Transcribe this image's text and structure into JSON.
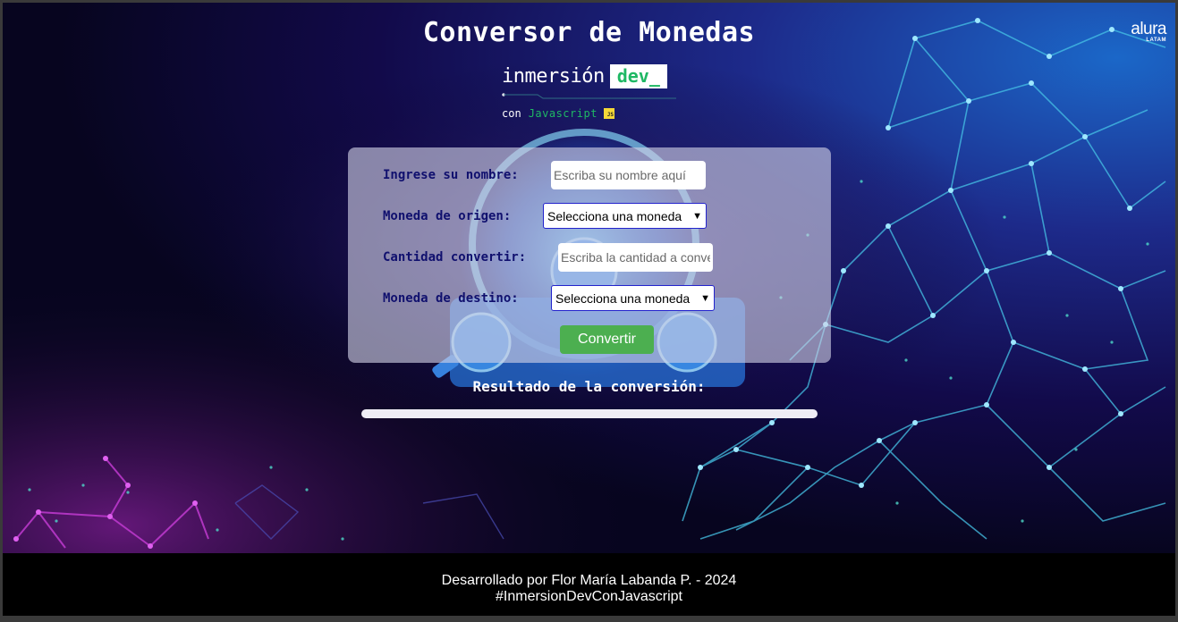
{
  "header": {
    "title": "Conversor de Monedas",
    "alura_logo": "alura",
    "alura_sub": "LATAM"
  },
  "brand": {
    "inmersion": "inmersión",
    "dev": "dev_",
    "con": "con",
    "javascript": "Javascript",
    "js_badge": "JS"
  },
  "form": {
    "name_label": "Ingrese su nombre:",
    "name_placeholder": "Escriba su nombre aquí",
    "origin_label": "Moneda de origen:",
    "origin_value": "Selecciona una moneda",
    "amount_label": "Cantidad convertir:",
    "amount_placeholder": "Escriba la cantidad a convertir",
    "target_label": "Moneda de destino:",
    "target_value": "Selecciona una moneda",
    "convert_button": "Convertir"
  },
  "result": {
    "label": "Resultado de la conversión:"
  },
  "footer": {
    "line1": "Desarrollado por Flor María Labanda P. - 2024",
    "line2": "#InmersionDevConJavascript"
  },
  "colors": {
    "background": "#07051f",
    "accent_green": "#4caf50",
    "label_navy": "#10106e",
    "network_cyan": "#46c3e6",
    "network_magenta": "#c03ad0"
  }
}
